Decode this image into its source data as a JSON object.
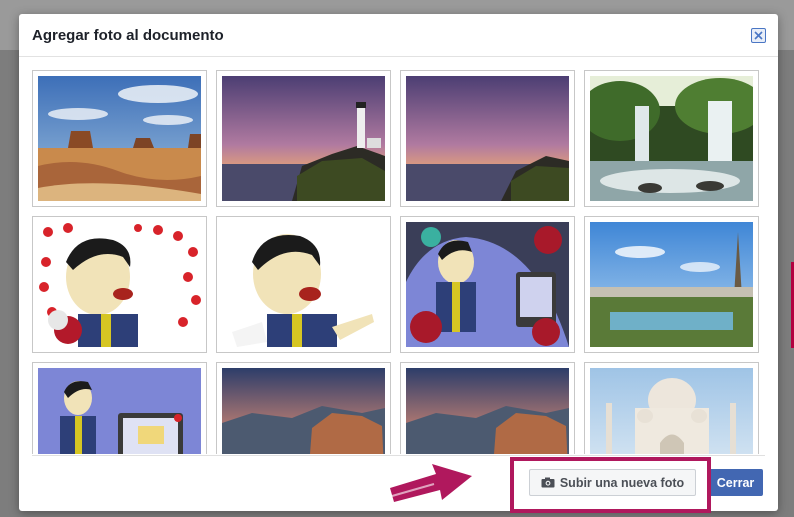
{
  "dialog": {
    "title": "Agregar foto al documento",
    "upload_label": "Subir una nueva foto",
    "close_label": "Cerrar"
  },
  "photos": [
    {
      "subject": "desert-buttes"
    },
    {
      "subject": "lighthouse-sunset"
    },
    {
      "subject": "coast-sunset"
    },
    {
      "subject": "waterfalls"
    },
    {
      "subject": "cartoon-hearts"
    },
    {
      "subject": "cartoon-presenter"
    },
    {
      "subject": "cartoon-flowers"
    },
    {
      "subject": "eiffel-tower"
    },
    {
      "subject": "cartoon-screen"
    },
    {
      "subject": "canyon-sunset"
    },
    {
      "subject": "canyon-sunset-2"
    },
    {
      "subject": "taj-mahal"
    }
  ],
  "colors": {
    "primary": "#4267b2",
    "highlight": "#b0185d"
  },
  "icons": {
    "close": "close-icon",
    "camera": "camera-icon",
    "arrow": "arrow-icon"
  }
}
